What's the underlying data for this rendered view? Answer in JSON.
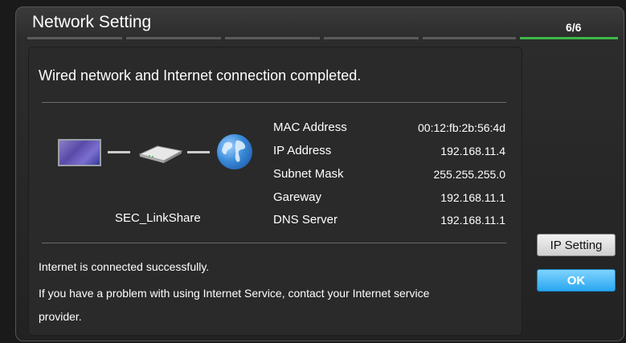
{
  "dialog": {
    "title": "Network Setting",
    "step": "6/6",
    "step_count": 6,
    "current_step": 6,
    "headline": "Wired network and Internet connection completed."
  },
  "diagram": {
    "device_name": "SEC_LinkShare",
    "icons": [
      "tv-icon",
      "router-icon",
      "globe-icon"
    ]
  },
  "network_info": [
    {
      "label": "MAC Address",
      "value": "00:12:fb:2b:56:4d"
    },
    {
      "label": "IP Address",
      "value": "192.168.11.4"
    },
    {
      "label": "Subnet Mask",
      "value": "255.255.255.0"
    },
    {
      "label": "Gareway",
      "value": "192.168.11.1"
    },
    {
      "label": "DNS Server",
      "value": "192.168.11.1"
    }
  ],
  "messages": {
    "status": "Internet is connected successfully.",
    "help_line1": "If you have a problem with using Internet Service, contact your Internet service",
    "help_line2": "provider."
  },
  "buttons": {
    "ip_setting": "IP Setting",
    "ok": "OK"
  },
  "colors": {
    "progress_active": "#3fb84a",
    "ok_button": "#2aa7f0"
  }
}
